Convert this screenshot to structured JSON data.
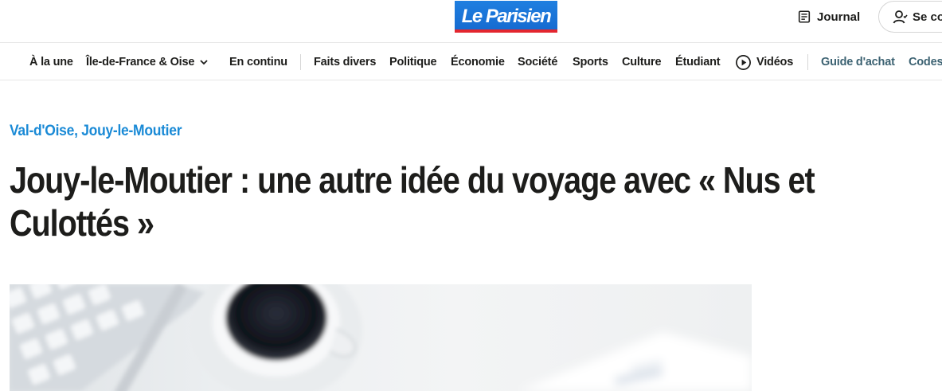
{
  "header": {
    "logo_text": "Le Parisien",
    "journal_label": "Journal",
    "login_label": "Se co"
  },
  "nav": {
    "items": [
      {
        "label": "À la une"
      },
      {
        "label": "Île-de-France & Oise"
      },
      {
        "label": "En continu"
      },
      {
        "label": "Faits divers"
      },
      {
        "label": "Politique"
      },
      {
        "label": "Économie"
      },
      {
        "label": "Société"
      },
      {
        "label": "Sports"
      },
      {
        "label": "Culture"
      },
      {
        "label": "Étudiant"
      },
      {
        "label": "Vidéos"
      },
      {
        "label": "Guide d'achat"
      },
      {
        "label": "Codes"
      }
    ]
  },
  "article": {
    "kicker": "Val-d'Oise, Jouy-le-Moutier",
    "headline_line1": "Jouy-le-Moutier : une autre idée du voyage avec « Nus et",
    "headline_line2": "Culottés »"
  },
  "colors": {
    "brand_blue": "#1a73e8",
    "brand_red": "#e3262f",
    "kicker_blue": "#1a8ad6",
    "nav_teal": "#3c6272",
    "text": "#1d1d1b"
  },
  "icons": {
    "journal": "newspaper-icon",
    "login": "user-icon",
    "dropdown": "chevron-down-icon",
    "videos": "play-circle-icon"
  }
}
